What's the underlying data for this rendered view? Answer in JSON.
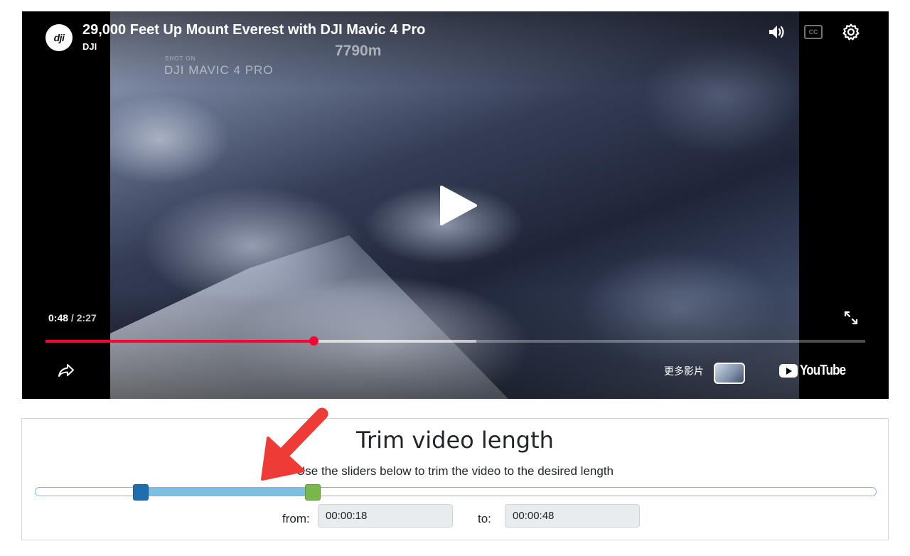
{
  "player": {
    "title": "29,000 Feet Up Mount Everest with DJI Mavic 4 Pro",
    "channel": "DJI",
    "logo_text": "dji",
    "overlay_shot_on": "SHOT ON",
    "overlay_model": "DJI MAVIC 4 PRO",
    "overlay_altitude": "7790m",
    "current_time": "0:48",
    "separator": " / ",
    "duration": "2:27",
    "progress_fraction": 0.327,
    "buffered_fraction": 0.526,
    "more_videos_label": "更多影片",
    "youtube_label": "YouTube",
    "cc_label": "CC",
    "icons": [
      "volume-icon",
      "captions-icon",
      "settings-icon",
      "play-icon",
      "fullscreen-icon",
      "share-icon"
    ]
  },
  "trim": {
    "title": "Trim video length",
    "subtitle": "Use the sliders below to trim the video to the desired length",
    "from_label": "from:",
    "to_label": "to:",
    "from_value": "00:00:18",
    "to_value": "00:00:48",
    "from_fraction": 0.124,
    "to_fraction": 0.329,
    "colors": {
      "range": "#7dbfdc",
      "from_handle": "#1e6fb0",
      "to_handle": "#78b84a"
    }
  },
  "annotation": {
    "arrow_color": "#ee3b36"
  },
  "colors": {
    "progress_played": "#ff0033"
  }
}
